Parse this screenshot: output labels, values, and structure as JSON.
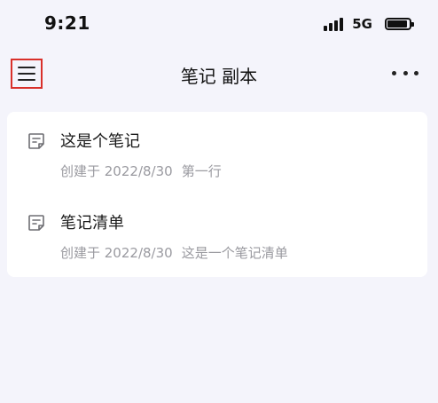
{
  "status_bar": {
    "time": "9:21",
    "network": "5G"
  },
  "nav": {
    "title": "笔记 副本",
    "menu_icon": "hamburger-menu-icon",
    "more_icon": "more-horizontal-icon"
  },
  "notes": [
    {
      "title": "这是个笔记",
      "created": "创建于 2022/8/30",
      "preview": "第一行",
      "icon": "note-icon"
    },
    {
      "title": "笔记清单",
      "created": "创建于 2022/8/30",
      "preview": "这是一个笔记清单",
      "icon": "note-icon"
    }
  ],
  "colors": {
    "background": "#f4f4fb",
    "card": "#ffffff",
    "highlight_border": "#d9302a",
    "meta_text": "#9a9aa0"
  }
}
